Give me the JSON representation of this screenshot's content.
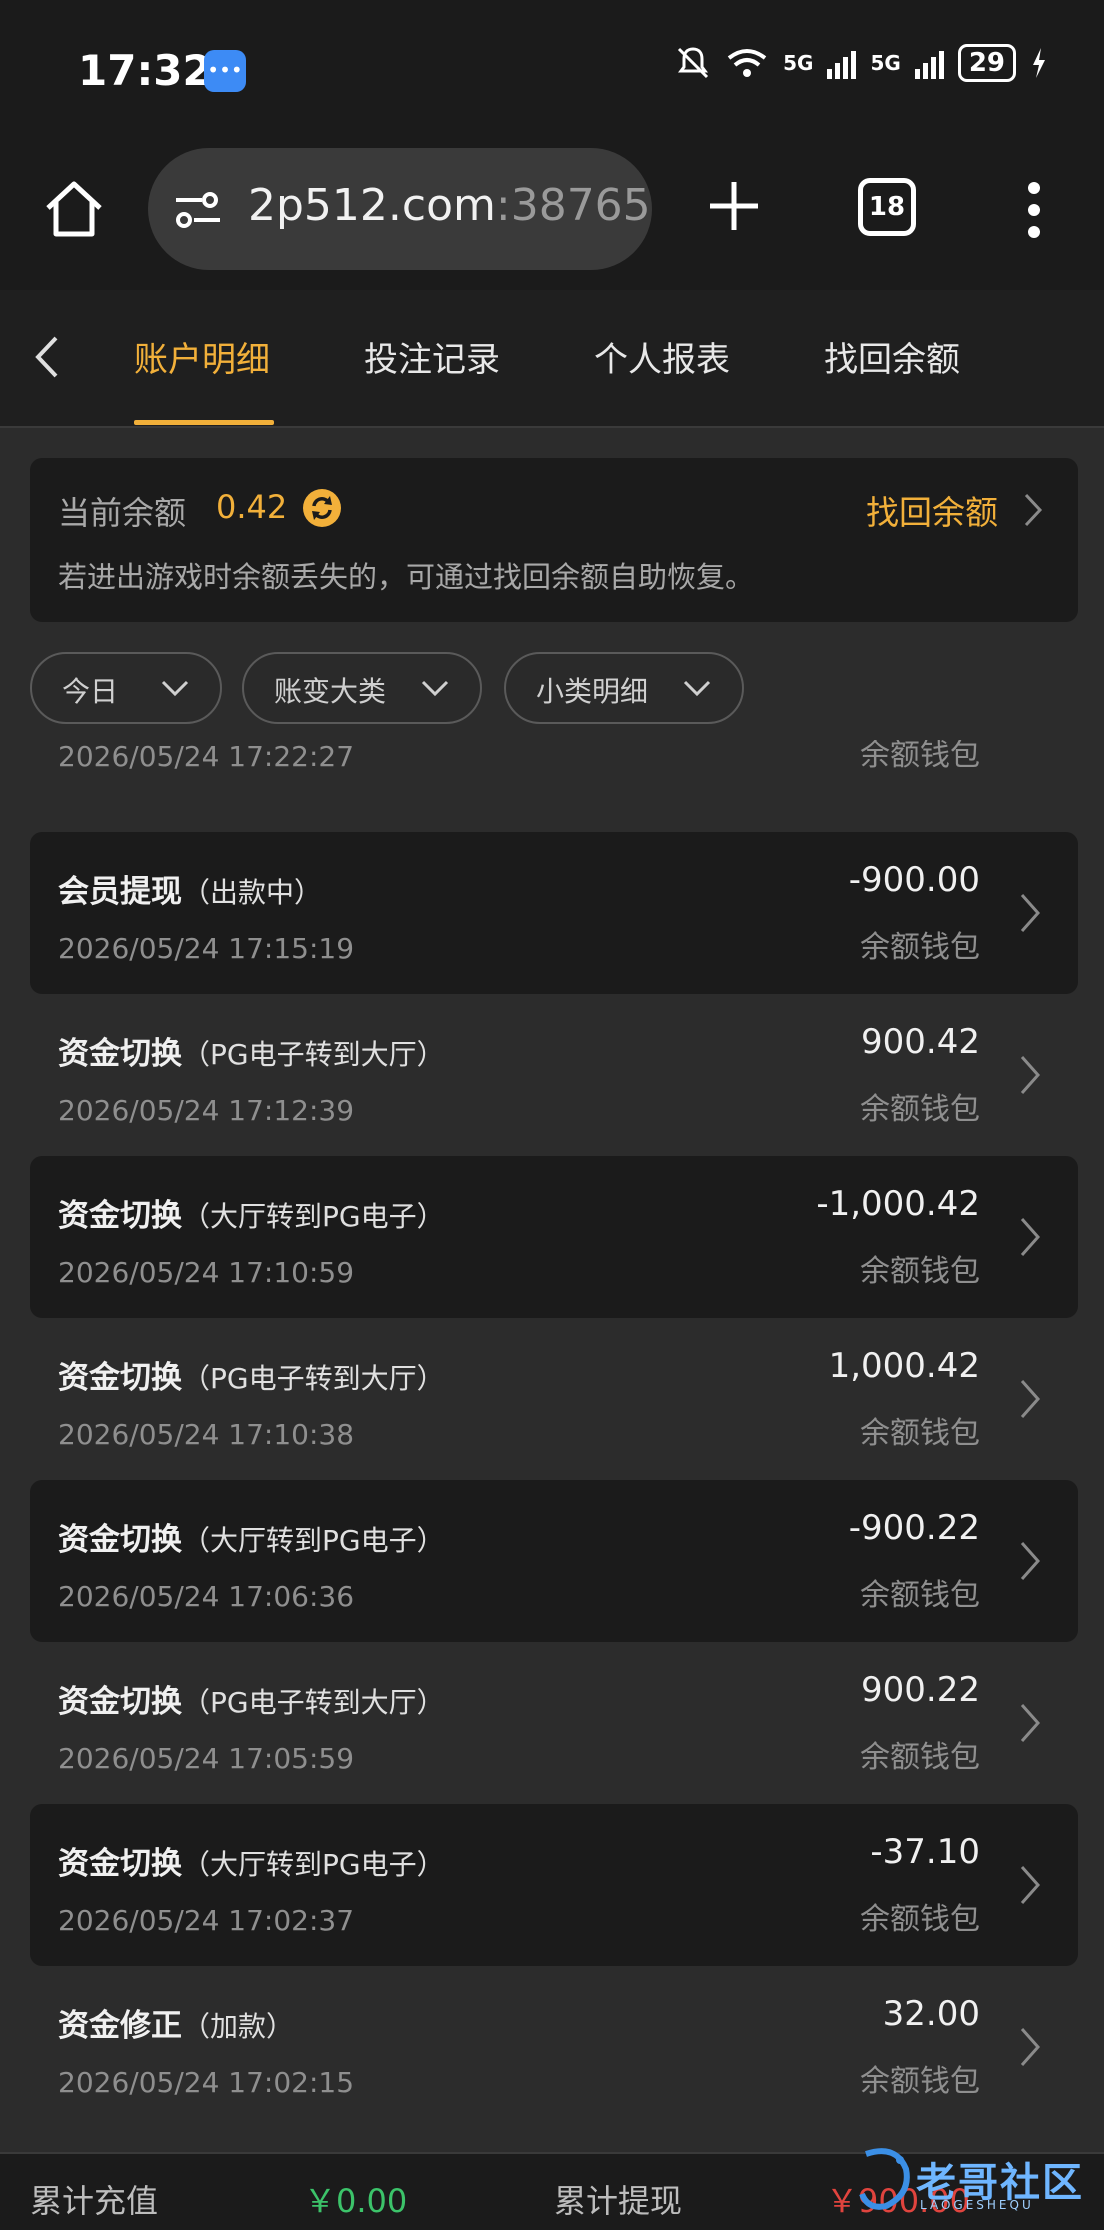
{
  "status_bar": {
    "time": "17:32",
    "signal1": "5G",
    "signal2": "5G",
    "battery": "29"
  },
  "browser": {
    "url_main": "2p512.com",
    "url_port": ":38765",
    "tab_count": "18"
  },
  "nav": {
    "tabs": [
      "账户明细",
      "投注记录",
      "个人报表",
      "找回余额"
    ]
  },
  "balance": {
    "label": "当前余额",
    "value": "0.42",
    "recover_label": "找回余额",
    "hint": "若进出游戏时余额丢失的，可通过找回余额自助恢复。"
  },
  "filters": [
    "今日",
    "账变大类",
    "小类明细"
  ],
  "transactions": [
    {
      "title": "",
      "sub": "",
      "amount": "",
      "wallet": "余额钱包",
      "time": "2026/05/24 17:22:27"
    },
    {
      "title": "会员提现",
      "sub": "（出款中）",
      "amount": "-900.00",
      "wallet": "余额钱包",
      "time": "2026/05/24 17:15:19"
    },
    {
      "title": "资金切换",
      "sub": "（PG电子转到大厅）",
      "amount": "900.42",
      "wallet": "余额钱包",
      "time": "2026/05/24 17:12:39"
    },
    {
      "title": "资金切换",
      "sub": "（大厅转到PG电子）",
      "amount": "-1,000.42",
      "wallet": "余额钱包",
      "time": "2026/05/24 17:10:59"
    },
    {
      "title": "资金切换",
      "sub": "（PG电子转到大厅）",
      "amount": "1,000.42",
      "wallet": "余额钱包",
      "time": "2026/05/24 17:10:38"
    },
    {
      "title": "资金切换",
      "sub": "（大厅转到PG电子）",
      "amount": "-900.22",
      "wallet": "余额钱包",
      "time": "2026/05/24 17:06:36"
    },
    {
      "title": "资金切换",
      "sub": "（PG电子转到大厅）",
      "amount": "900.22",
      "wallet": "余额钱包",
      "time": "2026/05/24 17:05:59"
    },
    {
      "title": "资金切换",
      "sub": "（大厅转到PG电子）",
      "amount": "-37.10",
      "wallet": "余额钱包",
      "time": "2026/05/24 17:02:37"
    },
    {
      "title": "资金修正",
      "sub": "（加款）",
      "amount": "32.00",
      "wallet": "余额钱包",
      "time": "2026/05/24 17:02:15"
    }
  ],
  "footer": {
    "deposit_label": "累计充值",
    "deposit_value": "￥0.00",
    "withdraw_label": "累计提现",
    "withdraw_value": "￥900.00"
  },
  "watermark": {
    "text": "老哥社区",
    "sub": "LAOGESHEQU"
  },
  "colors": {
    "accent": "#f2b03a",
    "positive": "#3cc36a",
    "negative": "#e0443e",
    "bg": "#2c2c2c",
    "card": "#1b1b1b"
  }
}
